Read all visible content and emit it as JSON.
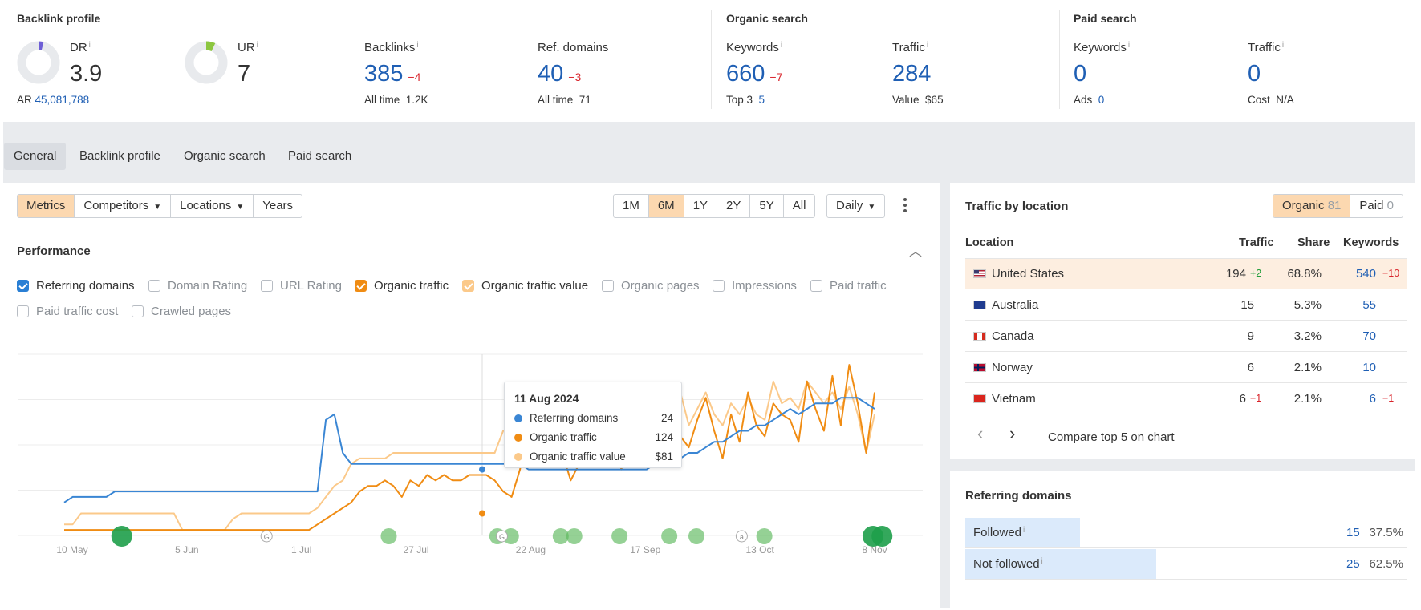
{
  "header": {
    "backlink_profile": {
      "title": "Backlink profile",
      "dr": {
        "label": "DR",
        "value": "3.9",
        "fraction": 0.039,
        "ring_color": "#6e5fd6"
      },
      "ur": {
        "label": "UR",
        "value": "7",
        "fraction": 0.07,
        "ring_color": "#8cc63f"
      },
      "ar_label": "AR",
      "ar_value": "45,081,788",
      "backlinks": {
        "label": "Backlinks",
        "value": "385",
        "delta": "−4",
        "sub_label": "All time",
        "sub_value": "1.2K"
      },
      "ref_domains": {
        "label": "Ref. domains",
        "value": "40",
        "delta": "−3",
        "sub_label": "All time",
        "sub_value": "71"
      }
    },
    "organic_search": {
      "title": "Organic search",
      "keywords": {
        "label": "Keywords",
        "value": "660",
        "delta": "−7",
        "sub_label": "Top 3",
        "sub_value": "5"
      },
      "traffic": {
        "label": "Traffic",
        "value": "284",
        "sub_label": "Value",
        "sub_value": "$65"
      }
    },
    "paid_search": {
      "title": "Paid search",
      "keywords": {
        "label": "Keywords",
        "value": "0",
        "sub_label": "Ads",
        "sub_value": "0"
      },
      "traffic": {
        "label": "Traffic",
        "value": "0",
        "sub_label": "Cost",
        "sub_value": "N/A"
      }
    },
    "info_glyph": "i"
  },
  "tabs": [
    "General",
    "Backlink profile",
    "Organic search",
    "Paid search"
  ],
  "toolbar": {
    "view_buttons": [
      "Metrics",
      "Competitors",
      "Locations",
      "Years"
    ],
    "range_buttons": [
      "1M",
      "6M",
      "1Y",
      "2Y",
      "5Y",
      "All"
    ],
    "active_range": "6M",
    "interval": "Daily",
    "caret": "▼"
  },
  "performance": {
    "title": "Performance",
    "collapse_glyph": "︿",
    "checkboxes": [
      {
        "label": "Referring domains",
        "checked": true,
        "color": "#2a7fd4"
      },
      {
        "label": "Domain Rating",
        "checked": false
      },
      {
        "label": "URL Rating",
        "checked": false
      },
      {
        "label": "Organic traffic",
        "checked": true,
        "color": "#f08c13"
      },
      {
        "label": "Organic traffic value",
        "checked": true,
        "color": "#fbc98a"
      },
      {
        "label": "Organic pages",
        "checked": false
      },
      {
        "label": "Impressions",
        "checked": false
      },
      {
        "label": "Paid traffic",
        "checked": false
      },
      {
        "label": "Paid traffic cost",
        "checked": false
      },
      {
        "label": "Crawled pages",
        "checked": false
      }
    ]
  },
  "chart_data": {
    "type": "line",
    "x_tick_labels": [
      "10 May",
      "5 Jun",
      "1 Jul",
      "27 Jul",
      "22 Aug",
      "17 Sep",
      "13 Oct",
      "8 Nov"
    ],
    "series": [
      {
        "name": "Referring domains",
        "color": "#3a86d4",
        "values": [
          12,
          14,
          14,
          14,
          14,
          14,
          16,
          16,
          16,
          16,
          16,
          16,
          16,
          16,
          16,
          16,
          16,
          16,
          16,
          16,
          16,
          16,
          16,
          16,
          16,
          16,
          16,
          16,
          16,
          16,
          16,
          42,
          44,
          30,
          26,
          26,
          26,
          26,
          26,
          26,
          26,
          26,
          26,
          26,
          26,
          26,
          26,
          26,
          26,
          26,
          26,
          26,
          26,
          26,
          26,
          24,
          24,
          24,
          24,
          24,
          24,
          24,
          24,
          24,
          24,
          24,
          24,
          24,
          24,
          24,
          26,
          28,
          28,
          28,
          30,
          30,
          32,
          34,
          34,
          36,
          38,
          38,
          40,
          40,
          42,
          44,
          46,
          44,
          46,
          48,
          48,
          48,
          50,
          50,
          50,
          48,
          46
        ]
      },
      {
        "name": "Organic traffic",
        "color": "#f08c13",
        "values": [
          2,
          2,
          2,
          2,
          2,
          2,
          2,
          2,
          2,
          2,
          2,
          2,
          2,
          2,
          2,
          2,
          2,
          2,
          2,
          2,
          2,
          2,
          2,
          2,
          2,
          2,
          2,
          2,
          2,
          2,
          4,
          6,
          8,
          10,
          12,
          16,
          18,
          18,
          20,
          18,
          14,
          20,
          18,
          22,
          20,
          22,
          20,
          20,
          22,
          22,
          22,
          20,
          16,
          14,
          24,
          40,
          26,
          28,
          34,
          30,
          20,
          26,
          42,
          30,
          28,
          38,
          24,
          36,
          28,
          40,
          46,
          30,
          48,
          36,
          32,
          42,
          50,
          38,
          28,
          44,
          34,
          52,
          40,
          36,
          48,
          44,
          42,
          34,
          56,
          46,
          38,
          58,
          40,
          62,
          48,
          30,
          52
        ]
      },
      {
        "name": "Organic traffic value",
        "color": "#fbc98a",
        "values": [
          4,
          4,
          8,
          8,
          8,
          8,
          8,
          8,
          8,
          8,
          8,
          8,
          8,
          8,
          2,
          2,
          2,
          2,
          2,
          2,
          6,
          8,
          8,
          8,
          8,
          8,
          8,
          8,
          8,
          8,
          10,
          14,
          18,
          20,
          26,
          28,
          28,
          28,
          28,
          30,
          30,
          30,
          30,
          30,
          30,
          30,
          30,
          30,
          30,
          30,
          30,
          30,
          38,
          38,
          36,
          38,
          38,
          38,
          36,
          36,
          38,
          38,
          44,
          36,
          34,
          44,
          40,
          44,
          38,
          36,
          48,
          40,
          44,
          52,
          40,
          46,
          52,
          44,
          40,
          48,
          44,
          50,
          44,
          42,
          56,
          48,
          50,
          46,
          56,
          52,
          48,
          52,
          46,
          54,
          44,
          30,
          44
        ]
      }
    ],
    "markers": [
      {
        "x": 0.115,
        "size": "large"
      },
      {
        "x": 0.41,
        "size": "small"
      },
      {
        "x": 0.53,
        "size": "small"
      },
      {
        "x": 0.545,
        "size": "small"
      },
      {
        "x": 0.6,
        "size": "small"
      },
      {
        "x": 0.615,
        "size": "small"
      },
      {
        "x": 0.665,
        "size": "small"
      },
      {
        "x": 0.72,
        "size": "small"
      },
      {
        "x": 0.75,
        "size": "small"
      },
      {
        "x": 0.825,
        "size": "small"
      },
      {
        "x": 0.945,
        "size": "large"
      },
      {
        "x": 0.955,
        "size": "large"
      }
    ],
    "annotations": [
      {
        "x": 0.275,
        "label": "G"
      },
      {
        "x": 0.535,
        "label": "G"
      },
      {
        "x": 0.8,
        "label": "a"
      }
    ],
    "grid": true
  },
  "tooltip": {
    "date": "11 Aug 2024",
    "rows": [
      {
        "name": "Referring domains",
        "value": "24",
        "color": "#3a86d4"
      },
      {
        "name": "Organic traffic",
        "value": "124",
        "color": "#f08c13"
      },
      {
        "name": "Organic traffic value",
        "value": "$81",
        "color": "#fbc98a"
      }
    ]
  },
  "traffic_by_location": {
    "title": "Traffic by location",
    "toggle": {
      "organic_label": "Organic",
      "organic_count": "81",
      "paid_label": "Paid",
      "paid_count": "0"
    },
    "columns": [
      "Location",
      "Traffic",
      "Share",
      "Keywords"
    ],
    "rows": [
      {
        "location": "United States",
        "traffic": "194",
        "traffic_delta": "+2",
        "share": "68.8%",
        "keywords": "540",
        "keywords_delta": "−10",
        "highlight": true
      },
      {
        "location": "Australia",
        "traffic": "15",
        "traffic_delta": "",
        "share": "5.3%",
        "keywords": "55",
        "keywords_delta": ""
      },
      {
        "location": "Canada",
        "traffic": "9",
        "traffic_delta": "",
        "share": "3.2%",
        "keywords": "70",
        "keywords_delta": ""
      },
      {
        "location": "Norway",
        "traffic": "6",
        "traffic_delta": "",
        "share": "2.1%",
        "keywords": "10",
        "keywords_delta": ""
      },
      {
        "location": "Vietnam",
        "traffic": "6",
        "traffic_delta": "−1",
        "share": "2.1%",
        "keywords": "6",
        "keywords_delta": "−1"
      }
    ],
    "prev_glyph": "‹",
    "next_glyph": "›",
    "compare_label": "Compare top 5 on chart"
  },
  "referring_domains": {
    "title": "Referring domains",
    "rows": [
      {
        "label": "Followed",
        "value": "15",
        "share": "37.5%",
        "fraction": 0.375
      },
      {
        "label": "Not followed",
        "value": "25",
        "share": "62.5%",
        "fraction": 0.625
      }
    ]
  }
}
